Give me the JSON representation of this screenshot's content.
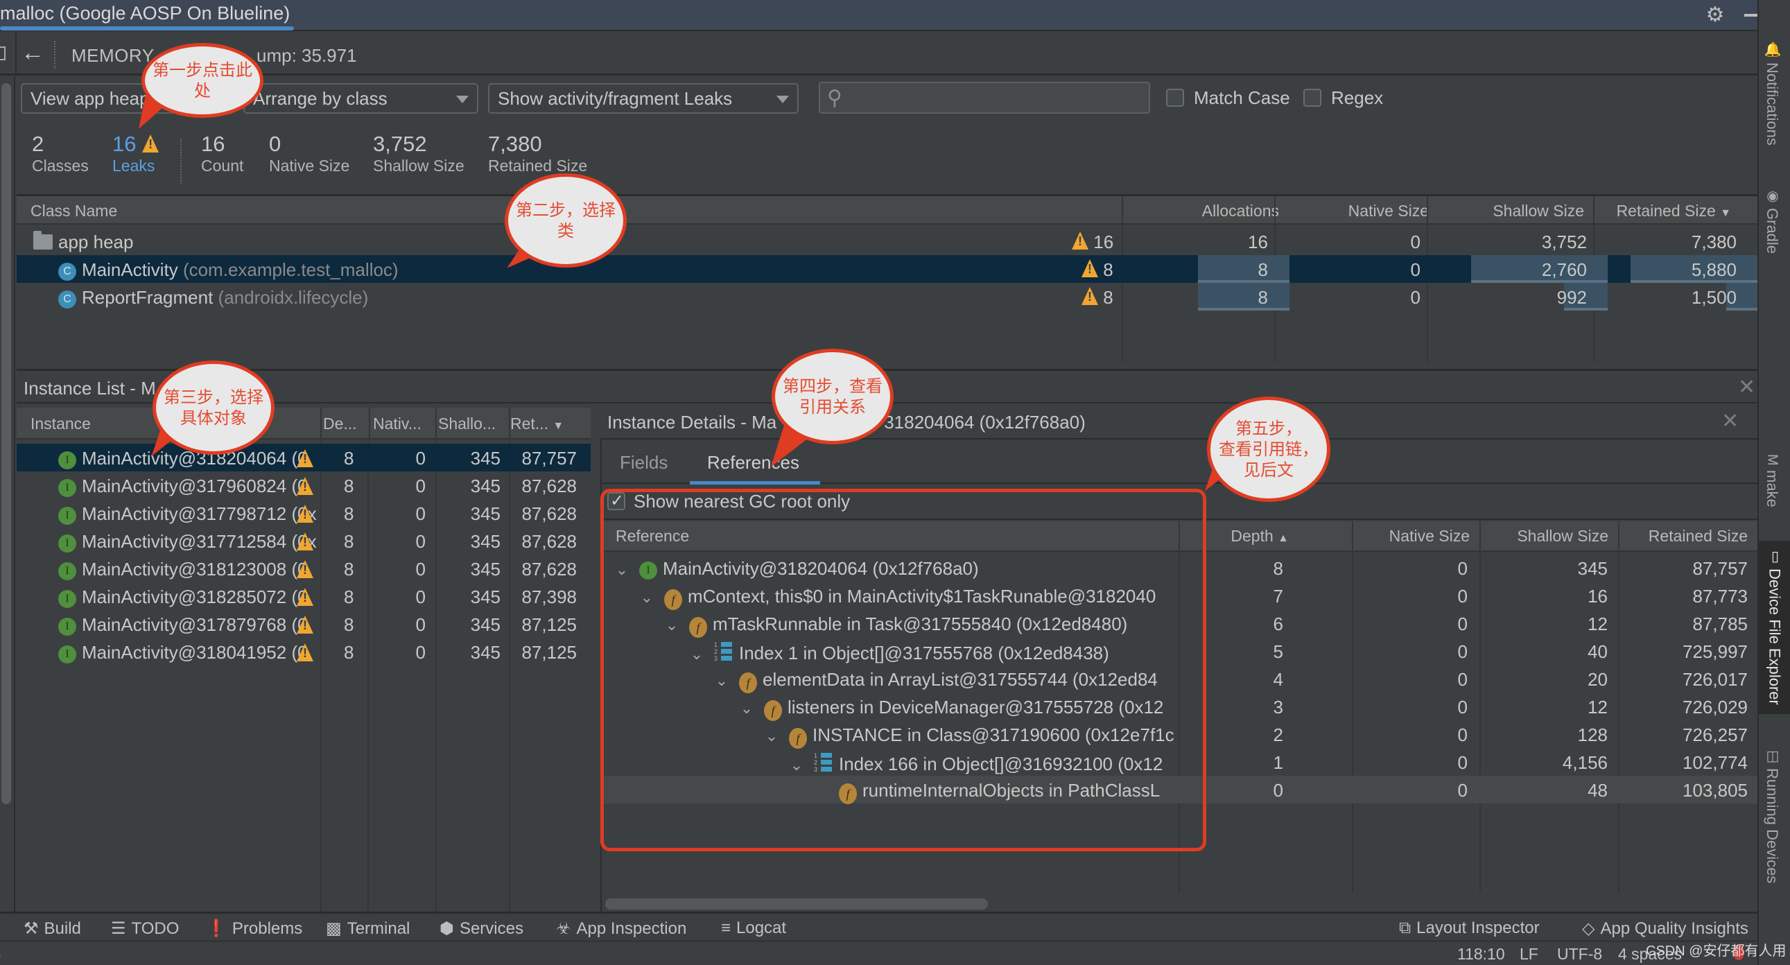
{
  "window": {
    "title": "malloc (Google AOSP On Blueline)",
    "icons": [
      "gear-icon",
      "minimize-icon"
    ]
  },
  "right_stripe": [
    {
      "label": "Notifications",
      "icon": "bell-icon",
      "active": false
    },
    {
      "label": "Gradle",
      "icon": "elephant-icon",
      "active": false
    },
    {
      "label": "make",
      "icon": "m-icon",
      "active": false
    },
    {
      "label": "Device File Explorer",
      "icon": "device-icon",
      "active": true
    },
    {
      "label": "Running Devices",
      "icon": "devices-icon",
      "active": false
    }
  ],
  "memory_header": {
    "title": "MEMORY",
    "dump_label": "ump: 35.971"
  },
  "toolbar": {
    "heap_select": "View app heap",
    "arrange_select": "Arrange by class",
    "filter_select": "Show activity/fragment Leaks",
    "search_placeholder": "",
    "match_case_label": "Match Case",
    "match_case_checked": false,
    "regex_label": "Regex",
    "regex_checked": false
  },
  "stats": [
    {
      "value": "2",
      "label": "Classes"
    },
    {
      "value": "16",
      "label": "Leaks",
      "warning": true
    },
    {
      "value": "16",
      "label": "Count"
    },
    {
      "value": "0",
      "label": "Native Size"
    },
    {
      "value": "3,752",
      "label": "Shallow Size"
    },
    {
      "value": "7,380",
      "label": "Retained Size"
    }
  ],
  "class_table": {
    "columns": [
      "Class Name",
      "Allocations",
      "Native Size",
      "Shallow Size",
      "Retained Size"
    ],
    "sort": "Retained Size descending",
    "rows": [
      {
        "name": "app heap",
        "pkg": "",
        "leaks": "16",
        "allocations": "16",
        "native": "0",
        "shallow": "3,752",
        "retained": "7,380",
        "selected": false,
        "icon": "folder-icon"
      },
      {
        "name": "MainActivity",
        "pkg": "(com.example.test_malloc)",
        "leaks": "8",
        "allocations": "8",
        "native": "0",
        "shallow": "2,760",
        "retained": "5,880",
        "selected": true,
        "icon": "class-icon"
      },
      {
        "name": "ReportFragment",
        "pkg": "(androidx.lifecycle)",
        "leaks": "8",
        "allocations": "8",
        "native": "0",
        "shallow": "992",
        "retained": "1,500",
        "selected": false,
        "icon": "class-icon"
      }
    ]
  },
  "instance_list": {
    "title": "Instance List - M",
    "columns": [
      "Instance",
      "De...",
      "Nativ...",
      "Shallo...",
      "Ret..."
    ],
    "rows": [
      {
        "name": "MainActivity@318204064 (0",
        "depth": "8",
        "native": "0",
        "shallow": "345",
        "retained": "87,757",
        "selected": true
      },
      {
        "name": "MainActivity@317960824 (0",
        "depth": "8",
        "native": "0",
        "shallow": "345",
        "retained": "87,628",
        "selected": false
      },
      {
        "name": "MainActivity@317798712 (0x",
        "depth": "8",
        "native": "0",
        "shallow": "345",
        "retained": "87,628",
        "selected": false
      },
      {
        "name": "MainActivity@317712584 (0x",
        "depth": "8",
        "native": "0",
        "shallow": "345",
        "retained": "87,628",
        "selected": false
      },
      {
        "name": "MainActivity@318123008 (0",
        "depth": "8",
        "native": "0",
        "shallow": "345",
        "retained": "87,628",
        "selected": false
      },
      {
        "name": "MainActivity@318285072 (0",
        "depth": "8",
        "native": "0",
        "shallow": "345",
        "retained": "87,398",
        "selected": false
      },
      {
        "name": "MainActivity@317879768 (0",
        "depth": "8",
        "native": "0",
        "shallow": "345",
        "retained": "87,125",
        "selected": false
      },
      {
        "name": "MainActivity@318041952 (0",
        "depth": "8",
        "native": "0",
        "shallow": "345",
        "retained": "87,125",
        "selected": false
      }
    ]
  },
  "instance_details": {
    "title_prefix": "Instance Details - Ma",
    "title_suffix": "318204064 (0x12f768a0)",
    "tabs": [
      {
        "label": "Fields",
        "active": false
      },
      {
        "label": "References",
        "active": true
      }
    ],
    "gc_root_label": "Show nearest GC root only",
    "gc_root_checked": true,
    "columns": [
      "Reference",
      "Depth",
      "Native Size",
      "Shallow Size",
      "Retained Size"
    ],
    "sort": "Depth ascending",
    "rows": [
      {
        "level": 0,
        "icon": "instance",
        "text": "MainActivity@318204064 (0x12f768a0)",
        "depth": "8",
        "native": "0",
        "shallow": "345",
        "retained": "87,757",
        "expanded": true
      },
      {
        "level": 1,
        "icon": "field",
        "text": "mContext, this$0 in MainActivity$1TaskRunable@3182040",
        "depth": "7",
        "native": "0",
        "shallow": "16",
        "retained": "87,773",
        "expanded": true
      },
      {
        "level": 2,
        "icon": "field",
        "text": "mTaskRunnable in Task@317555840 (0x12ed8480)",
        "depth": "6",
        "native": "0",
        "shallow": "12",
        "retained": "87,785",
        "expanded": true
      },
      {
        "level": 3,
        "icon": "array",
        "text": "Index 1 in Object[]@317555768 (0x12ed8438)",
        "depth": "5",
        "native": "0",
        "shallow": "40",
        "retained": "725,997",
        "expanded": true
      },
      {
        "level": 4,
        "icon": "field",
        "text": "elementData in ArrayList@317555744 (0x12ed84",
        "depth": "4",
        "native": "0",
        "shallow": "20",
        "retained": "726,017",
        "expanded": true
      },
      {
        "level": 5,
        "icon": "field",
        "text": "listeners in DeviceManager@317555728 (0x12",
        "depth": "3",
        "native": "0",
        "shallow": "12",
        "retained": "726,029",
        "expanded": true
      },
      {
        "level": 6,
        "icon": "field",
        "text": "INSTANCE in Class@317190600 (0x12e7f1c",
        "depth": "2",
        "native": "0",
        "shallow": "128",
        "retained": "726,257",
        "expanded": true
      },
      {
        "level": 7,
        "icon": "array",
        "text": "Index 166 in Object[]@316932100 (0x12",
        "depth": "1",
        "native": "0",
        "shallow": "4,156",
        "retained": "102,774",
        "expanded": true
      },
      {
        "level": 8,
        "icon": "field",
        "text": "runtimeInternalObjects in PathClassL",
        "depth": "0",
        "native": "0",
        "shallow": "48",
        "retained": "103,805",
        "expanded": false,
        "highlighted": true
      }
    ]
  },
  "annotations": [
    {
      "id": "step1",
      "text": "第一步点击此\n处"
    },
    {
      "id": "step2",
      "text": "第二步，选择\n类"
    },
    {
      "id": "step3",
      "text": "第三步，选择\n具体对象"
    },
    {
      "id": "step4",
      "text": "第四步，查看\n引用关系"
    },
    {
      "id": "step5",
      "text": "第五步，\n查看引用链，\n见后文"
    }
  ],
  "bottom_tools": [
    {
      "label": "Build",
      "icon": "hammer-icon"
    },
    {
      "label": "TODO",
      "icon": "list-icon"
    },
    {
      "label": "Problems",
      "icon": "problems-icon"
    },
    {
      "label": "Terminal",
      "icon": "terminal-icon"
    },
    {
      "label": "Services",
      "icon": "services-icon"
    },
    {
      "label": "App Inspection",
      "icon": "inspection-icon"
    },
    {
      "label": "Logcat",
      "icon": "logcat-icon"
    },
    {
      "label": "Layout Inspector",
      "icon": "layout-inspector-icon"
    },
    {
      "label": "App Quality Insights",
      "icon": "diamond-icon"
    }
  ],
  "status_bar": {
    "left_fragment": ")",
    "position": "118:10",
    "line_sep": "LF",
    "encoding": "UTF-8",
    "indent": "4 spaces",
    "watermark": "CSDN @安仔都有人用"
  }
}
